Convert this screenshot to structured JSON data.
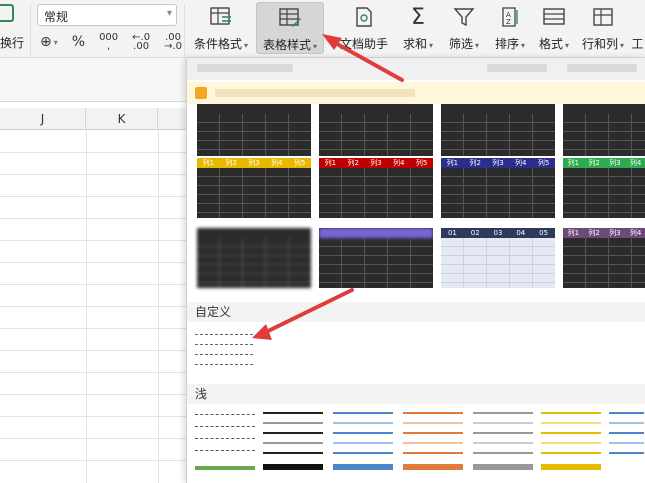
{
  "ribbon": {
    "left_label": "换行",
    "number_format": "常规",
    "num_icons": [
      "¥",
      "%",
      "000",
      ".00",
      ".0"
    ],
    "buttons": [
      {
        "label": "条件格式",
        "icon": "conditional-format-icon"
      },
      {
        "label": "表格样式",
        "icon": "table-style-icon",
        "active": true
      },
      {
        "label": "文档助手",
        "icon": "document-assistant-icon"
      },
      {
        "label": "求和",
        "icon": "sum-icon"
      },
      {
        "label": "筛选",
        "icon": "filter-icon"
      },
      {
        "label": "排序",
        "icon": "sort-icon"
      },
      {
        "label": "格式",
        "icon": "format-icon"
      },
      {
        "label": "行和列",
        "icon": "rows-columns-icon"
      },
      {
        "label": "工",
        "icon": "worksheet-icon"
      }
    ]
  },
  "sheet": {
    "columns": [
      "J",
      "K"
    ]
  },
  "panel": {
    "style_headers": {
      "col_label": "列1",
      "cols_short": [
        "列1",
        "列2",
        "列3",
        "列4",
        "列5"
      ],
      "light_cols": [
        "01",
        "02",
        "03",
        "04",
        "05"
      ]
    },
    "section_custom": "自定义",
    "section_light": "浅",
    "colors": {
      "yellow": "#e6b800",
      "red": "#c00000",
      "navy": "#2b2e8e",
      "green": "#2eaa50",
      "purple": "#7a64d6",
      "slate": "#2e3a5c",
      "mauve": "#6e4a7a",
      "accent_arrow": "#e03c3c"
    }
  }
}
